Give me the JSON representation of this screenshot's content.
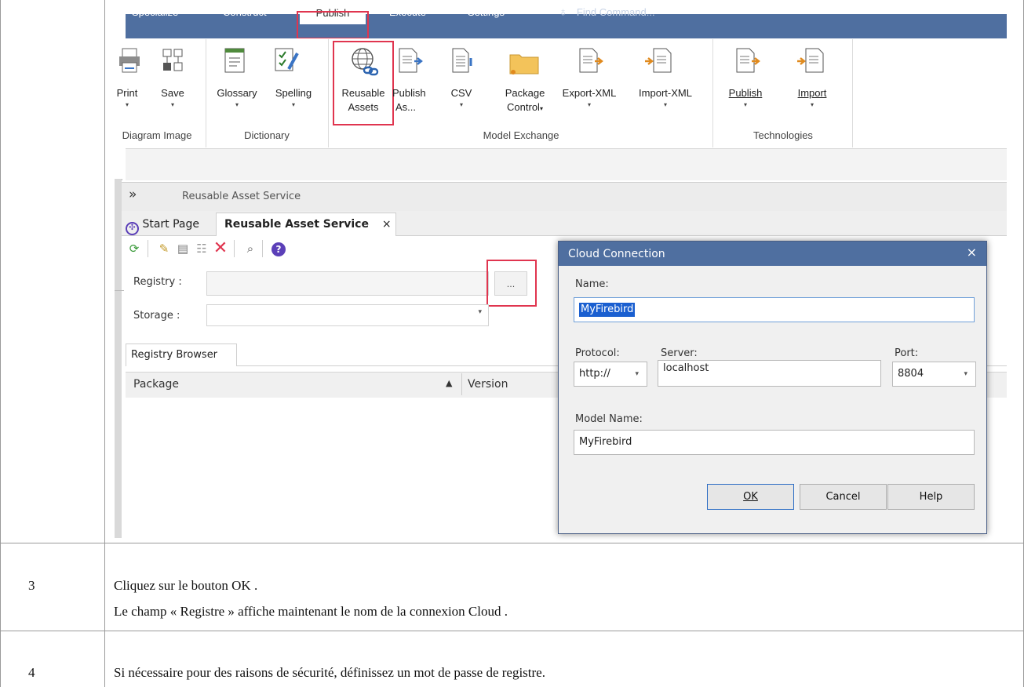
{
  "ribbon": {
    "tabs": [
      "Specialize",
      "Construct",
      "Publish",
      "Execute",
      "Settings"
    ],
    "find_placeholder": "Find Command...",
    "buttons": {
      "print": "Print",
      "save": "Save",
      "glossary": "Glossary",
      "spelling": "Spelling",
      "reusable_1": "Reusable",
      "reusable_2": "Assets",
      "publish_as_1": "Publish",
      "publish_as_2": "As...",
      "csv": "CSV",
      "package_control_1": "Package",
      "package_control_2": "Control",
      "export_xml": "Export-XML",
      "import_xml": "Import-XML",
      "tech_publish": "Publish",
      "tech_import": "Import"
    },
    "groups": [
      "Diagram Image",
      "Dictionary",
      "Model Exchange",
      "Technologies"
    ],
    "caret": "▾"
  },
  "panel": {
    "header_chevron": "»",
    "header_title": "Reusable Asset Service",
    "tabs": [
      "Start Page",
      "Reusable Asset Service"
    ],
    "tab_close": "×",
    "registry_label": "Registry :",
    "storage_label": "Storage :",
    "ellipsis": "...",
    "browser_tab": "Registry Browser",
    "col_package": "Package",
    "col_version": "Version",
    "sort_arrow": "▲"
  },
  "dialog": {
    "title": "Cloud Connection",
    "close": "×",
    "name_label": "Name:",
    "name_value": "MyFirebird",
    "protocol_label": "Protocol:",
    "protocol_value": "http://",
    "server_label": "Server:",
    "server_value": "localhost",
    "port_label": "Port:",
    "port_value": "8804",
    "model_label": "Model Name:",
    "model_value": "MyFirebird",
    "ok": "OK",
    "cancel": "Cancel",
    "help": "Help"
  },
  "steps": [
    {
      "num": "3",
      "lines": [
        "Cliquez sur le bouton OK .",
        "Le champ « Registre » affiche maintenant le nom de la connexion Cloud ."
      ]
    },
    {
      "num": "4",
      "lines": [
        "Si nécessaire pour des raisons de sécurité, définissez un mot de passe de registre."
      ]
    }
  ],
  "colors": {
    "ribbon": "#4f6fa0",
    "highlight": "#e0354f"
  }
}
